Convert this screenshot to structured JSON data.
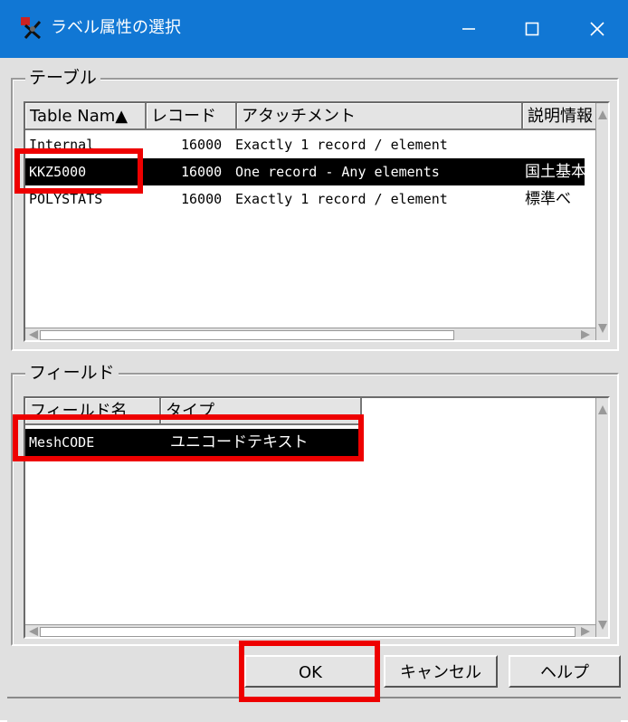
{
  "window": {
    "title": "ラベル属性の選択",
    "minimize": "—",
    "maximize": "☐",
    "close": "✕"
  },
  "table_group": {
    "label": "テーブル",
    "columns": [
      "Table Nam▲",
      "レコード",
      "アタッチメント",
      "説明情報"
    ],
    "rows": [
      {
        "name": "Internal",
        "records": "16000",
        "attachment": "Exactly 1 record / element",
        "description": ""
      },
      {
        "name": "KKZ5000",
        "records": "16000",
        "attachment": "One record - Any elements",
        "description": "国土基本"
      },
      {
        "name": "POLYSTATS",
        "records": "16000",
        "attachment": "Exactly 1 record / element",
        "description": "標準べ"
      }
    ],
    "selected_row": "KKZ5000"
  },
  "field_group": {
    "label": "フィールド",
    "columns": [
      "フィールド名",
      "タイプ"
    ],
    "rows": [
      {
        "name": "MeshCODE",
        "type": "ユニコードテキスト"
      }
    ]
  },
  "buttons": {
    "ok": "OK",
    "cancel": "キャンセル",
    "help": "ヘルプ"
  },
  "colors": {
    "titlebar": "#1177d4",
    "highlight": "#ee0000",
    "selection": "#000000"
  }
}
